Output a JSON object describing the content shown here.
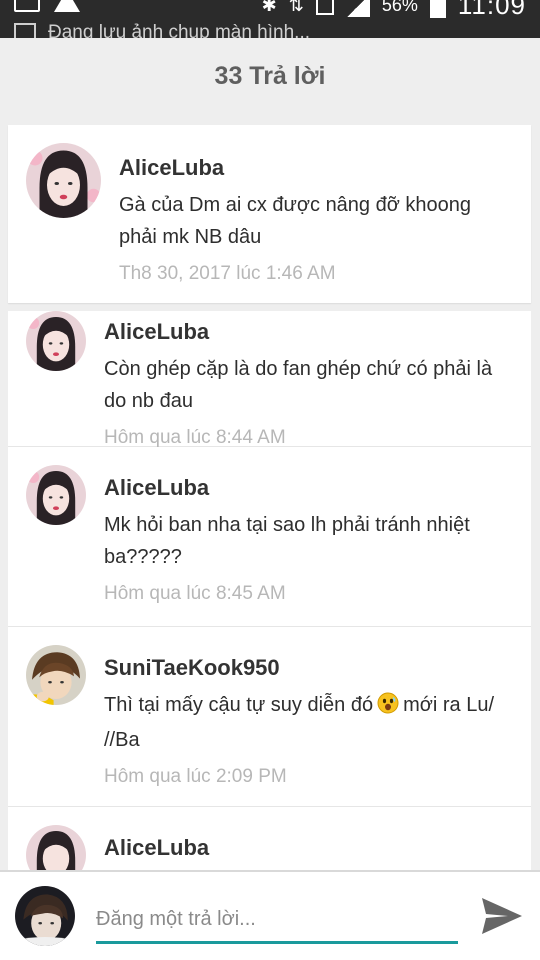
{
  "status_bar": {
    "battery": "56%",
    "clock": "11:09",
    "notification": "Đang lưu ảnh chụp màn hình..."
  },
  "header": {
    "title": "33 Trả lời"
  },
  "first_reply": {
    "username": "AliceLuba",
    "text": "Gà của Dm ai cx được nâng đỡ khoong phải mk NB dâu",
    "time": "Th8 30, 2017 lúc 1:46 AM"
  },
  "replies": [
    {
      "username": "AliceLuba",
      "text": "Còn ghép cặp là do fan ghép chứ có phải là do nb đau",
      "time": "Hôm qua lúc 8:44 AM"
    },
    {
      "username": "AliceLuba",
      "text": "Mk hỏi ban nha tại sao lh phải tránh nhiệt ba?????",
      "time": "Hôm qua lúc 8:45 AM"
    },
    {
      "username": "SuniTaeKook950",
      "text_before": "Thì tại mấy cậu tự suy diễn đó",
      "text_after": "mới ra Lu/ //Ba",
      "time": "Hôm qua lúc 2:09 PM"
    },
    {
      "username": "AliceLuba"
    }
  ],
  "composer": {
    "placeholder": "Đăng một trả lời..."
  },
  "icons": {
    "send": "send-icon",
    "gallery": "image-icon",
    "warning": "warning-icon",
    "emoji": "surprised-face-emoji"
  },
  "colors": {
    "accent": "#1a9a9c",
    "status_bar": "#2b2b2b",
    "background": "#eeeeee",
    "timestamp": "#b7b7b7"
  }
}
